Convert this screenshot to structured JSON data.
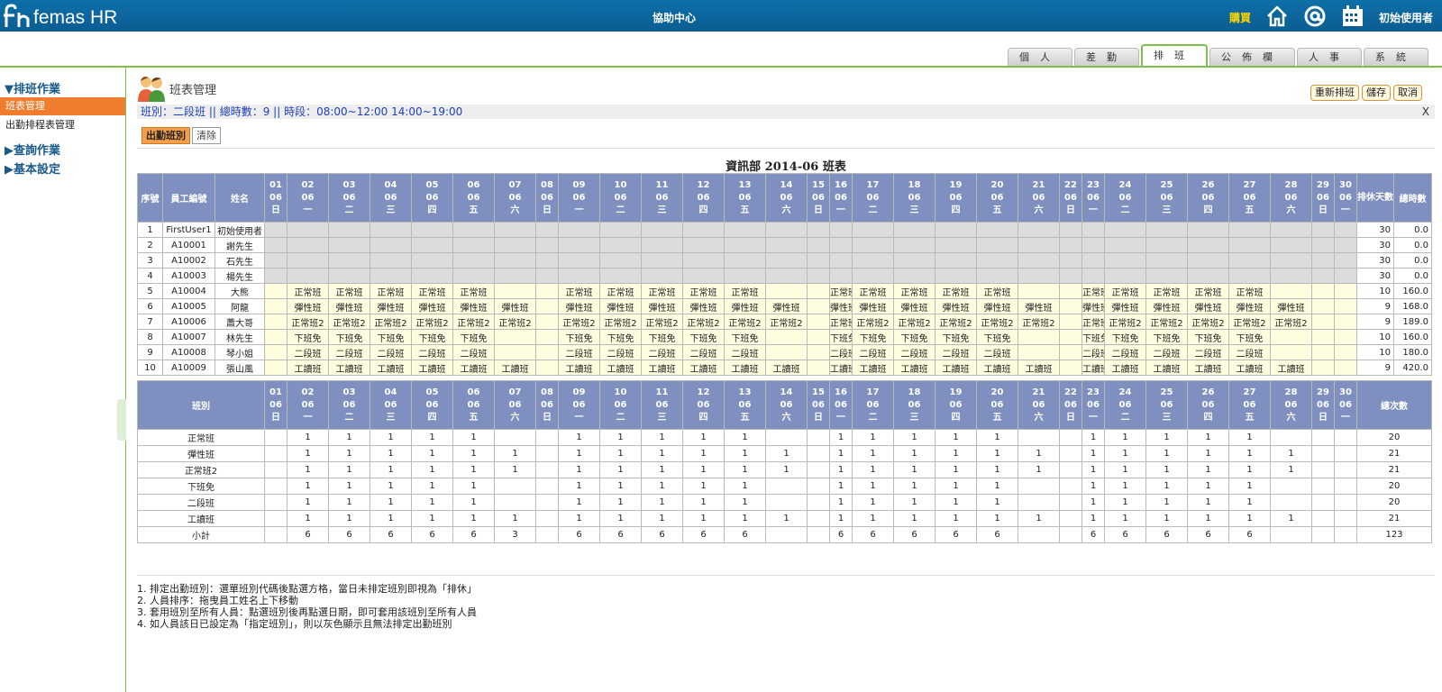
{
  "header": {
    "logo": "femas HR",
    "help": "協助中心",
    "buy": "購買",
    "user": "初始使用者",
    "brand_color": "#0e6fa8",
    "accent": "#7cc04b"
  },
  "tabs": [
    {
      "label": "個人",
      "active": false
    },
    {
      "label": "差勤",
      "active": false
    },
    {
      "label": "排班",
      "active": true
    },
    {
      "label": "公佈欄",
      "active": false
    },
    {
      "label": "人事",
      "active": false
    },
    {
      "label": "系統",
      "active": false
    }
  ],
  "sidebar": {
    "sections": [
      {
        "label": "▼排班作業",
        "items": [
          {
            "label": "班表管理",
            "active": true
          },
          {
            "label": "出勤排程表管理",
            "active": false
          }
        ]
      },
      {
        "label": "▶查詢作業",
        "items": []
      },
      {
        "label": "▶基本設定",
        "items": []
      }
    ]
  },
  "page": {
    "title": "班表管理",
    "info": "班別：二段班 || 總時數：9 || 時段：08:00~12:00  14:00~19:00",
    "close": "X",
    "btn_attend": "出勤班別",
    "btn_clear": "清除",
    "actions": [
      "重新排班",
      "儲存",
      "取消"
    ],
    "table_title": "資訊部 2014-06 班表"
  },
  "schedule": {
    "month": "06",
    "days": [
      [
        "01",
        "日"
      ],
      [
        "02",
        "一"
      ],
      [
        "03",
        "二"
      ],
      [
        "04",
        "三"
      ],
      [
        "05",
        "四"
      ],
      [
        "06",
        "五"
      ],
      [
        "07",
        "六"
      ],
      [
        "08",
        "日"
      ],
      [
        "09",
        "一"
      ],
      [
        "10",
        "二"
      ],
      [
        "11",
        "三"
      ],
      [
        "12",
        "四"
      ],
      [
        "13",
        "五"
      ],
      [
        "14",
        "六"
      ],
      [
        "15",
        "日"
      ],
      [
        "16",
        "一"
      ],
      [
        "17",
        "二"
      ],
      [
        "18",
        "三"
      ],
      [
        "19",
        "四"
      ],
      [
        "20",
        "五"
      ],
      [
        "21",
        "六"
      ],
      [
        "22",
        "日"
      ],
      [
        "23",
        "一"
      ],
      [
        "24",
        "二"
      ],
      [
        "25",
        "三"
      ],
      [
        "26",
        "四"
      ],
      [
        "27",
        "五"
      ],
      [
        "28",
        "六"
      ],
      [
        "29",
        "日"
      ],
      [
        "30",
        "一"
      ]
    ],
    "headers": {
      "seq": "序號",
      "emp_id": "員工編號",
      "name": "姓名",
      "rest": "排休天數",
      "hours": "總時數",
      "shift": "班別",
      "count": "總次數",
      "subtotal": "小計"
    },
    "employees": [
      {
        "seq": "1",
        "id": "FirstUser1",
        "name": "初始使用者",
        "shift": "",
        "pattern": "none",
        "rest": "30",
        "hours": "0.0"
      },
      {
        "seq": "2",
        "id": "A10001",
        "name": "謝先生",
        "shift": "",
        "pattern": "none",
        "rest": "30",
        "hours": "0.0"
      },
      {
        "seq": "3",
        "id": "A10002",
        "name": "石先生",
        "shift": "",
        "pattern": "none",
        "rest": "30",
        "hours": "0.0"
      },
      {
        "seq": "4",
        "id": "A10003",
        "name": "楊先生",
        "shift": "",
        "pattern": "none",
        "rest": "30",
        "hours": "0.0"
      },
      {
        "seq": "5",
        "id": "A10004",
        "name": "大熊",
        "shift": "正常班",
        "pattern": "weekday",
        "rest": "10",
        "hours": "160.0"
      },
      {
        "seq": "6",
        "id": "A10005",
        "name": "阿龍",
        "shift": "彈性班",
        "pattern": "sat",
        "rest": "9",
        "hours": "168.0"
      },
      {
        "seq": "7",
        "id": "A10006",
        "name": "蕭大哥",
        "shift": "正常班2",
        "pattern": "sat",
        "rest": "9",
        "hours": "189.0"
      },
      {
        "seq": "8",
        "id": "A10007",
        "name": "林先生",
        "shift": "下班免",
        "pattern": "weekday",
        "rest": "10",
        "hours": "160.0"
      },
      {
        "seq": "9",
        "id": "A10008",
        "name": "琴小姐",
        "shift": "二段班",
        "pattern": "weekday",
        "rest": "10",
        "hours": "180.0"
      },
      {
        "seq": "10",
        "id": "A10009",
        "name": "張山風",
        "shift": "工讀班",
        "pattern": "sat",
        "rest": "9",
        "hours": "420.0"
      }
    ],
    "summary": [
      {
        "shift": "正常班",
        "pattern": "weekday",
        "total": "20"
      },
      {
        "shift": "彈性班",
        "pattern": "sat",
        "total": "21"
      },
      {
        "shift": "正常班2",
        "pattern": "sat",
        "total": "21"
      },
      {
        "shift": "下班免",
        "pattern": "weekday",
        "total": "20"
      },
      {
        "shift": "二段班",
        "pattern": "weekday",
        "total": "20"
      },
      {
        "shift": "工讀班",
        "pattern": "sat",
        "total": "21"
      }
    ],
    "subtotal": {
      "weekday": "6",
      "sat": "3",
      "total": "123"
    }
  },
  "notes": [
    "1. 排定出勤班別：選單班別代碼後點選方格，當日未排定班別即視為「排休」",
    "2. 人員排序：拖曳員工姓名上下移動",
    "3. 套用班別至所有人員：點選班別後再點選日期，即可套用該班別至所有人員",
    "4. 如人員該日已設定為「指定班別」，則以灰色顯示且無法排定出勤班別"
  ]
}
